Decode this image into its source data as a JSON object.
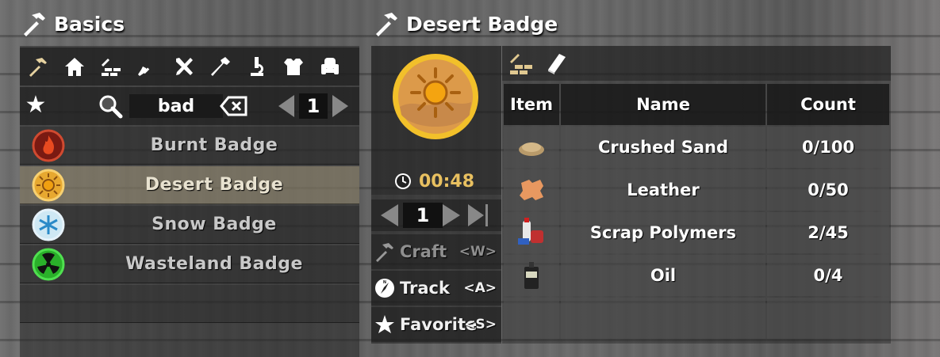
{
  "left_panel": {
    "title": "Basics",
    "categories": [
      "basics-icon",
      "home-icon",
      "building-icon",
      "weapons-icon",
      "tools-icon",
      "food-icon",
      "science-icon",
      "armor-icon",
      "decor-icon"
    ],
    "search": {
      "value": "bad"
    },
    "page": "1",
    "recipes": [
      {
        "name": "Burnt Badge",
        "icon": "burnt-badge-icon",
        "color": "#c0301e"
      },
      {
        "name": "Desert Badge",
        "icon": "desert-badge-icon",
        "color": "#f0a020",
        "selected": true
      },
      {
        "name": "Snow Badge",
        "icon": "snow-badge-icon",
        "color": "#a8d8f0"
      },
      {
        "name": "Wasteland Badge",
        "icon": "wasteland-badge-icon",
        "color": "#30b030"
      }
    ]
  },
  "detail": {
    "title": "Desert Badge",
    "craft_time": "00:48",
    "quantity": "1",
    "actions": {
      "craft": {
        "label": "Craft",
        "key": "<W>",
        "disabled": true
      },
      "track": {
        "label": "Track",
        "key": "<A>"
      },
      "favorite": {
        "label": "Favorite",
        "key": "<S>"
      }
    }
  },
  "ingredients": {
    "tabs": [
      "workbench-icon",
      "book-icon"
    ],
    "headers": {
      "item": "Item",
      "name": "Name",
      "count": "Count"
    },
    "rows": [
      {
        "icon": "crushed-sand-icon",
        "name": "Crushed Sand",
        "count": "0/100"
      },
      {
        "icon": "leather-icon",
        "name": "Leather",
        "count": "0/50"
      },
      {
        "icon": "scrap-polymers-icon",
        "name": "Scrap Polymers",
        "count": "2/45"
      },
      {
        "icon": "oil-icon",
        "name": "Oil",
        "count": "0/4"
      }
    ]
  },
  "colors": {
    "accent": "#e8c060",
    "selected_row": "#cdbe96",
    "panel": "#232323"
  }
}
